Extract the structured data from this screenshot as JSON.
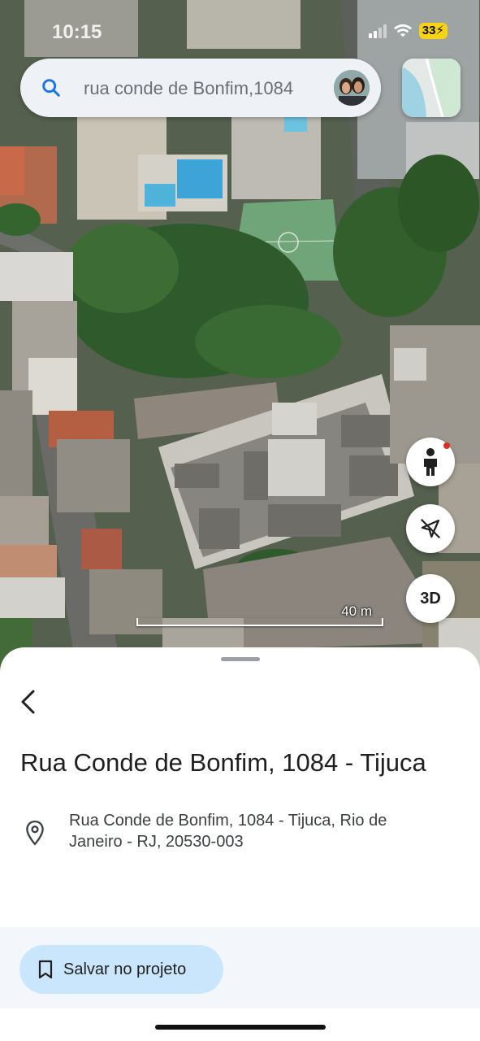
{
  "status_bar": {
    "time": "10:15",
    "battery": "33"
  },
  "search": {
    "query": "rua conde de Bonfim,1084"
  },
  "map": {
    "scale_label": "40 m",
    "three_d_label": "3D"
  },
  "sheet": {
    "title": "Rua Conde de Bonfim, 1084 - Tijuca",
    "address": "Rua Conde de Bonfim, 1084 - Tijuca, Rio de Janeiro - RJ, 20530-003",
    "save_label": "Salvar no projeto"
  },
  "colors": {
    "save_button_bg": "#c9e6fc",
    "search_icon": "#1a73e8",
    "battery_badge": "#f7d215",
    "pegman_dot": "#d93025"
  }
}
